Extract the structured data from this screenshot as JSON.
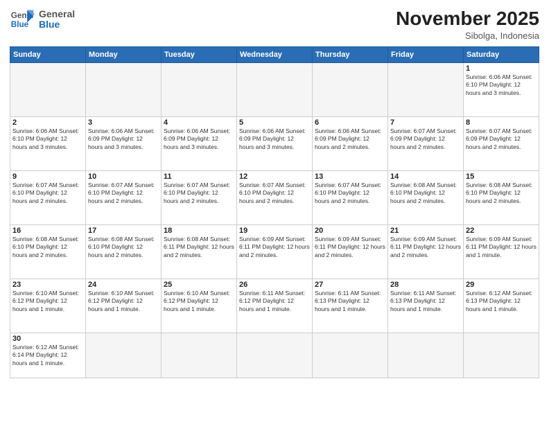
{
  "header": {
    "logo_general": "General",
    "logo_blue": "Blue",
    "month_title": "November 2025",
    "subtitle": "Sibolga, Indonesia"
  },
  "days_of_week": [
    "Sunday",
    "Monday",
    "Tuesday",
    "Wednesday",
    "Thursday",
    "Friday",
    "Saturday"
  ],
  "weeks": [
    [
      {
        "day": "",
        "info": ""
      },
      {
        "day": "",
        "info": ""
      },
      {
        "day": "",
        "info": ""
      },
      {
        "day": "",
        "info": ""
      },
      {
        "day": "",
        "info": ""
      },
      {
        "day": "",
        "info": ""
      },
      {
        "day": "1",
        "info": "Sunrise: 6:06 AM\nSunset: 6:10 PM\nDaylight: 12 hours and 3 minutes."
      }
    ],
    [
      {
        "day": "2",
        "info": "Sunrise: 6:06 AM\nSunset: 6:10 PM\nDaylight: 12 hours and 3 minutes."
      },
      {
        "day": "3",
        "info": "Sunrise: 6:06 AM\nSunset: 6:09 PM\nDaylight: 12 hours and 3 minutes."
      },
      {
        "day": "4",
        "info": "Sunrise: 6:06 AM\nSunset: 6:09 PM\nDaylight: 12 hours and 3 minutes."
      },
      {
        "day": "5",
        "info": "Sunrise: 6:06 AM\nSunset: 6:09 PM\nDaylight: 12 hours and 3 minutes."
      },
      {
        "day": "6",
        "info": "Sunrise: 6:06 AM\nSunset: 6:09 PM\nDaylight: 12 hours and 2 minutes."
      },
      {
        "day": "7",
        "info": "Sunrise: 6:07 AM\nSunset: 6:09 PM\nDaylight: 12 hours and 2 minutes."
      },
      {
        "day": "8",
        "info": "Sunrise: 6:07 AM\nSunset: 6:09 PM\nDaylight: 12 hours and 2 minutes."
      }
    ],
    [
      {
        "day": "9",
        "info": "Sunrise: 6:07 AM\nSunset: 6:10 PM\nDaylight: 12 hours and 2 minutes."
      },
      {
        "day": "10",
        "info": "Sunrise: 6:07 AM\nSunset: 6:10 PM\nDaylight: 12 hours and 2 minutes."
      },
      {
        "day": "11",
        "info": "Sunrise: 6:07 AM\nSunset: 6:10 PM\nDaylight: 12 hours and 2 minutes."
      },
      {
        "day": "12",
        "info": "Sunrise: 6:07 AM\nSunset: 6:10 PM\nDaylight: 12 hours and 2 minutes."
      },
      {
        "day": "13",
        "info": "Sunrise: 6:07 AM\nSunset: 6:10 PM\nDaylight: 12 hours and 2 minutes."
      },
      {
        "day": "14",
        "info": "Sunrise: 6:08 AM\nSunset: 6:10 PM\nDaylight: 12 hours and 2 minutes."
      },
      {
        "day": "15",
        "info": "Sunrise: 6:08 AM\nSunset: 6:10 PM\nDaylight: 12 hours and 2 minutes."
      }
    ],
    [
      {
        "day": "16",
        "info": "Sunrise: 6:08 AM\nSunset: 6:10 PM\nDaylight: 12 hours and 2 minutes."
      },
      {
        "day": "17",
        "info": "Sunrise: 6:08 AM\nSunset: 6:10 PM\nDaylight: 12 hours and 2 minutes."
      },
      {
        "day": "18",
        "info": "Sunrise: 6:08 AM\nSunset: 6:11 PM\nDaylight: 12 hours and 2 minutes."
      },
      {
        "day": "19",
        "info": "Sunrise: 6:09 AM\nSunset: 6:11 PM\nDaylight: 12 hours and 2 minutes."
      },
      {
        "day": "20",
        "info": "Sunrise: 6:09 AM\nSunset: 6:11 PM\nDaylight: 12 hours and 2 minutes."
      },
      {
        "day": "21",
        "info": "Sunrise: 6:09 AM\nSunset: 6:11 PM\nDaylight: 12 hours and 2 minutes."
      },
      {
        "day": "22",
        "info": "Sunrise: 6:09 AM\nSunset: 6:11 PM\nDaylight: 12 hours and 1 minute."
      }
    ],
    [
      {
        "day": "23",
        "info": "Sunrise: 6:10 AM\nSunset: 6:12 PM\nDaylight: 12 hours and 1 minute."
      },
      {
        "day": "24",
        "info": "Sunrise: 6:10 AM\nSunset: 6:12 PM\nDaylight: 12 hours and 1 minute."
      },
      {
        "day": "25",
        "info": "Sunrise: 6:10 AM\nSunset: 6:12 PM\nDaylight: 12 hours and 1 minute."
      },
      {
        "day": "26",
        "info": "Sunrise: 6:11 AM\nSunset: 6:12 PM\nDaylight: 12 hours and 1 minute."
      },
      {
        "day": "27",
        "info": "Sunrise: 6:11 AM\nSunset: 6:13 PM\nDaylight: 12 hours and 1 minute."
      },
      {
        "day": "28",
        "info": "Sunrise: 6:11 AM\nSunset: 6:13 PM\nDaylight: 12 hours and 1 minute."
      },
      {
        "day": "29",
        "info": "Sunrise: 6:12 AM\nSunset: 6:13 PM\nDaylight: 12 hours and 1 minute."
      }
    ],
    [
      {
        "day": "30",
        "info": "Sunrise: 6:12 AM\nSunset: 6:14 PM\nDaylight: 12 hours and 1 minute."
      },
      {
        "day": "",
        "info": ""
      },
      {
        "day": "",
        "info": ""
      },
      {
        "day": "",
        "info": ""
      },
      {
        "day": "",
        "info": ""
      },
      {
        "day": "",
        "info": ""
      },
      {
        "day": "",
        "info": ""
      }
    ]
  ]
}
